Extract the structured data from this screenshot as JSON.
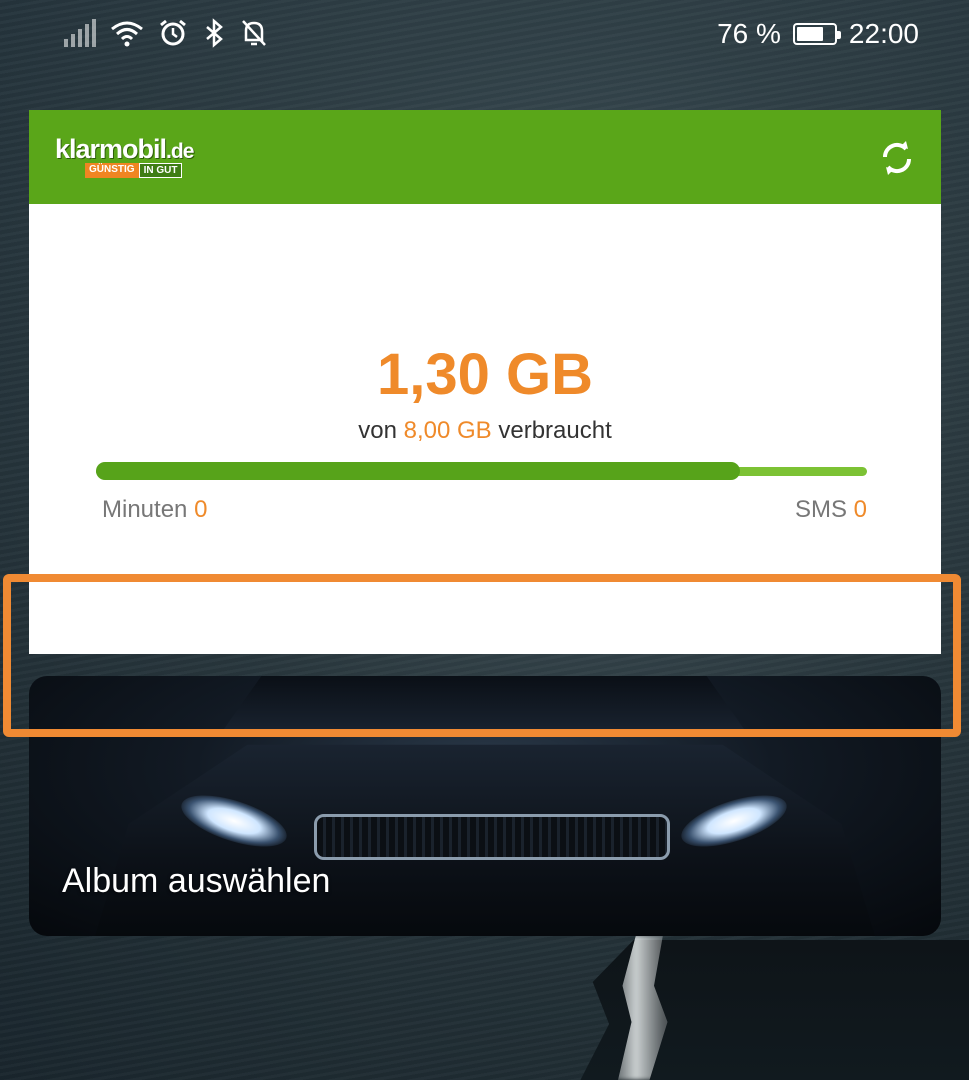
{
  "status_bar": {
    "battery_percent": "76 %",
    "battery_level": 0.76,
    "time": "22:00",
    "icons": [
      "signal-icon",
      "wifi-icon",
      "alarm-icon",
      "bluetooth-icon",
      "notifications-off-icon"
    ]
  },
  "widget": {
    "brand": {
      "name": "klarmobil",
      "tld": ".de",
      "tag_left": "GÜNSTIG",
      "tag_right": "IN GUT"
    },
    "refresh_icon": "refresh-icon",
    "usage": {
      "used": "1,30 GB",
      "prefix": "von",
      "limit": "8,00 GB",
      "suffix": "verbraucht",
      "bar_fill_fraction": 0.835
    },
    "minutes": {
      "label": "Minuten",
      "value": "0"
    },
    "sms": {
      "label": "SMS",
      "value": "0"
    },
    "colors": {
      "brand_green": "#5aa619",
      "accent_orange": "#ef8a2a"
    }
  },
  "album": {
    "label": "Album auswählen"
  },
  "highlight": {
    "color": "#f08a33"
  }
}
